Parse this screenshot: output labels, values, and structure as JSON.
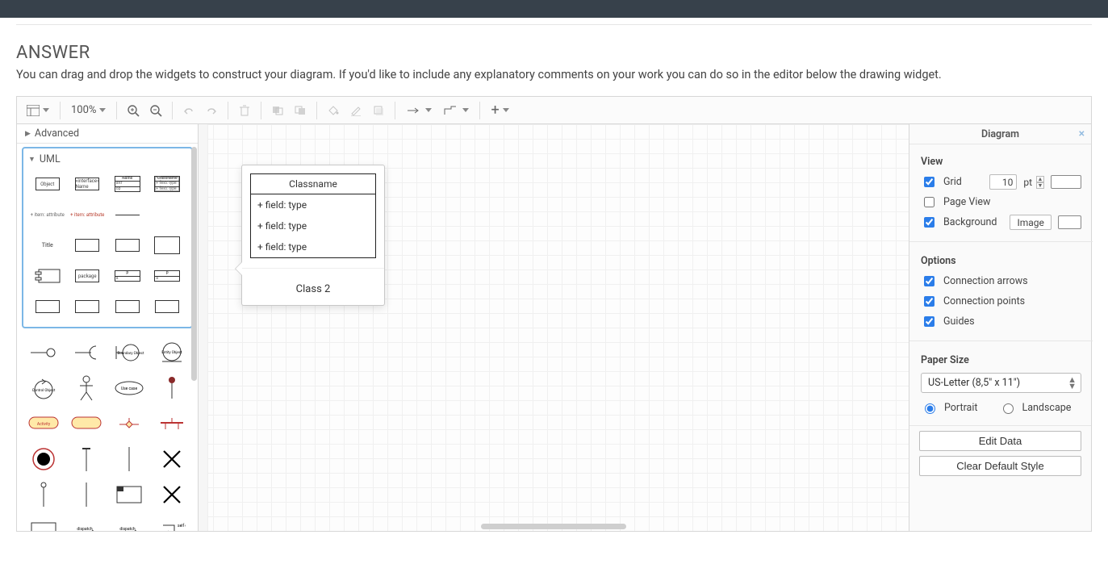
{
  "header": {
    "title": "ANSWER",
    "subtitle": "You can drag and drop the widgets to construct your diagram. If you'd like to include any explanatory comments on your work you can do so in the editor below the drawing widget."
  },
  "toolbar": {
    "zoom_label": "100%"
  },
  "sidebar": {
    "advanced_label": "Advanced",
    "uml_label": "UML",
    "thumbs": {
      "object": "Object",
      "interface": "«interface»\nName",
      "classname": "Classname",
      "item1": "+ item: attribute",
      "item2": "+ item: attribute",
      "title": "Title",
      "package": "package",
      "boundary": "Boundary Object",
      "entity": "Entity Object",
      "control": "Control Object",
      "usecase": "Use case",
      "activity": "Activity",
      "selfcall": "self call"
    }
  },
  "canvas_shape": {
    "classname": "Classname",
    "field1": "+ field: type",
    "field2": "+ field: type",
    "field3": "+ field: type",
    "caption": "Class 2"
  },
  "inspector": {
    "title": "Diagram",
    "view_title": "View",
    "grid_label": "Grid",
    "grid_value": "10",
    "grid_unit": "pt",
    "pageview_label": "Page View",
    "background_label": "Background",
    "image_btn": "Image",
    "options_title": "Options",
    "conn_arrows": "Connection arrows",
    "conn_points": "Connection points",
    "guides": "Guides",
    "paper_title": "Paper Size",
    "paper_value": "US-Letter (8,5\" x 11\")",
    "orient_portrait": "Portrait",
    "orient_landscape": "Landscape",
    "edit_data": "Edit Data",
    "clear_style": "Clear Default Style"
  }
}
